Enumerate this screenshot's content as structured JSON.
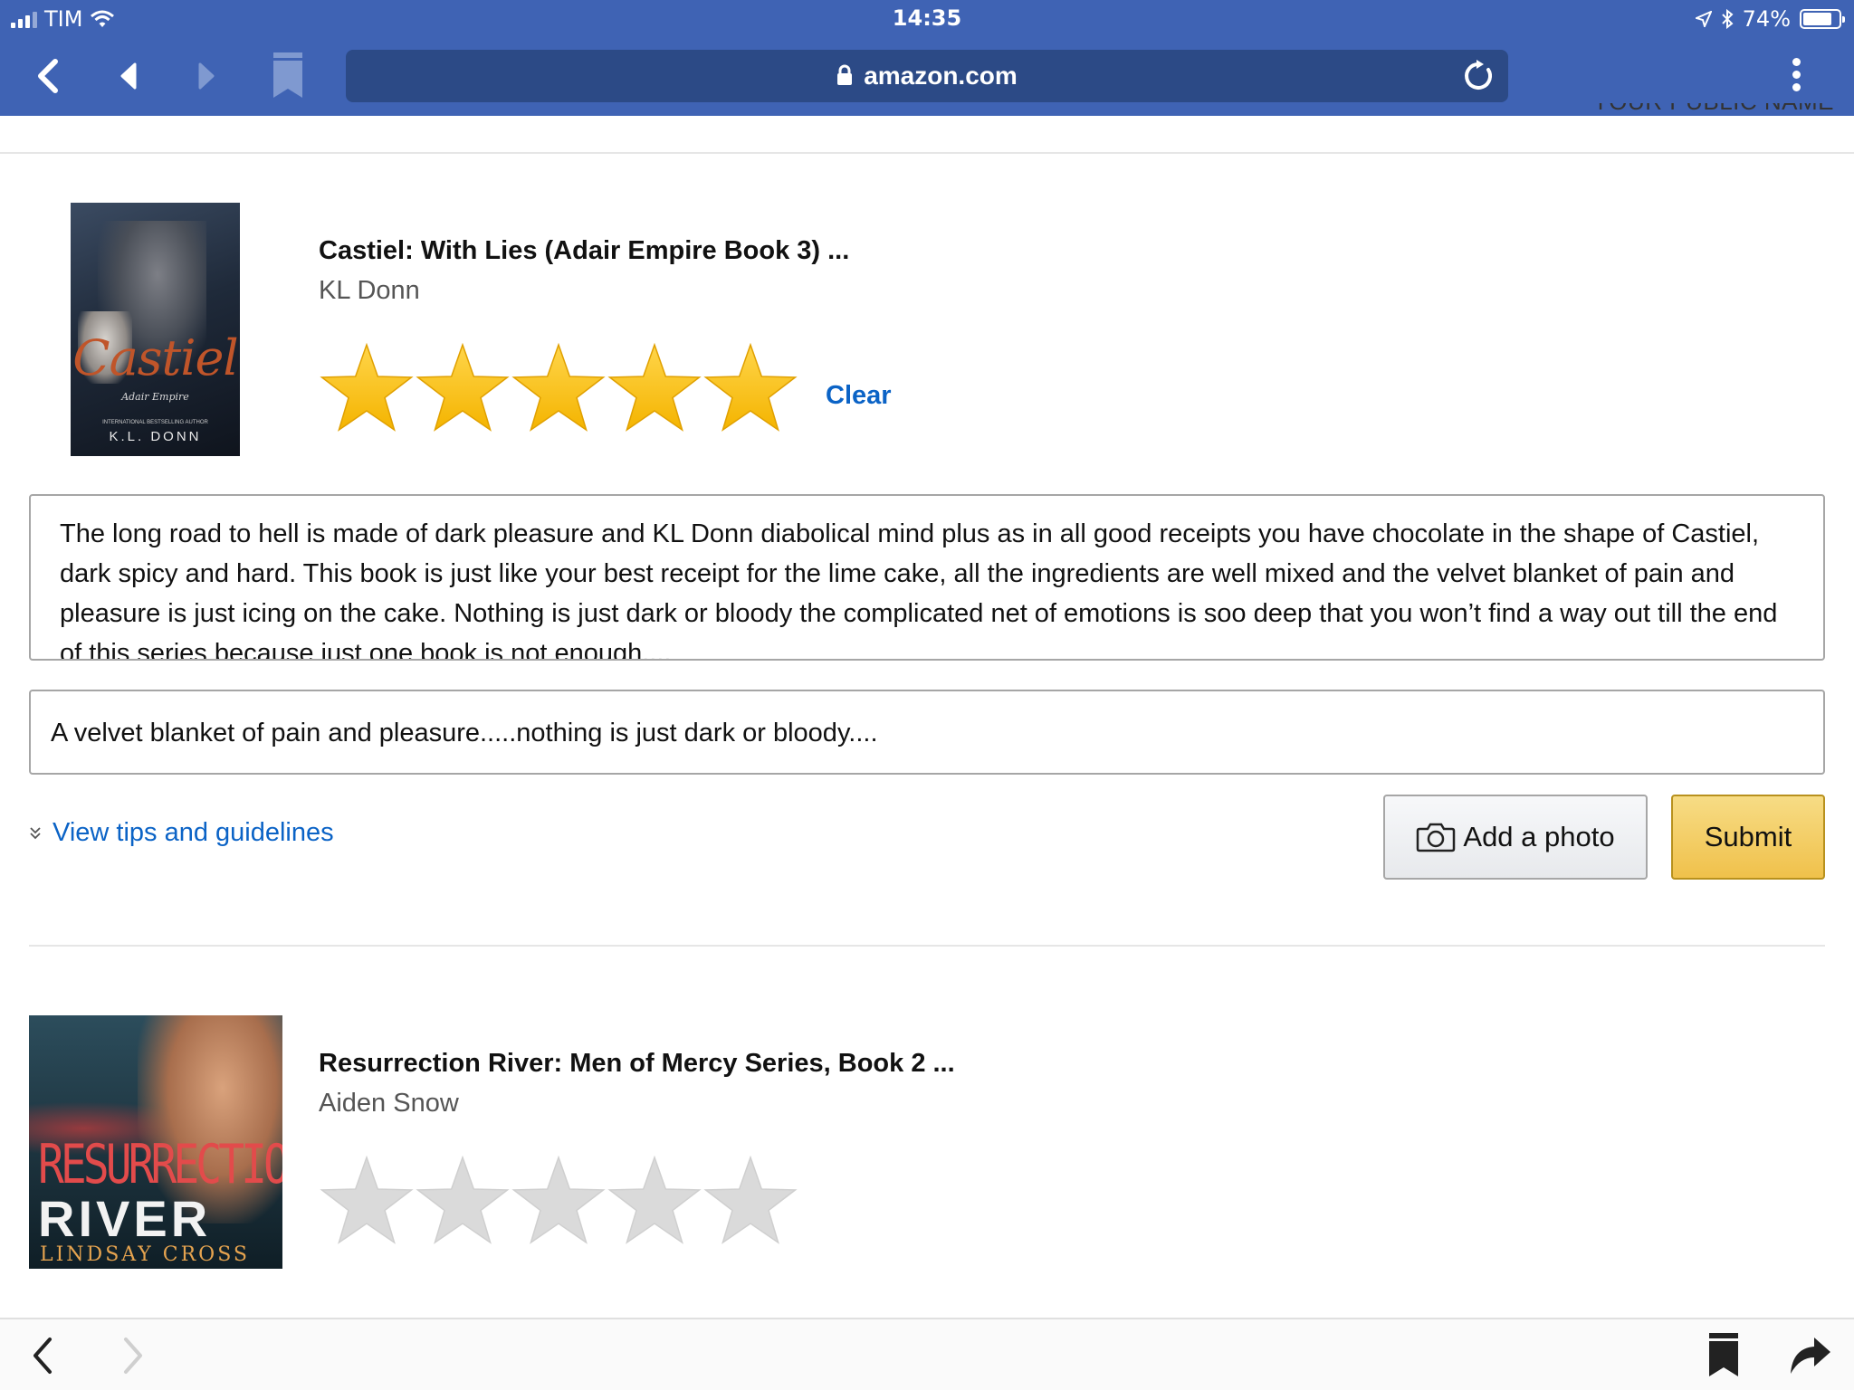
{
  "status_bar": {
    "carrier": "TIM",
    "time": "14:35",
    "battery": "74%"
  },
  "browser": {
    "url": "amazon.com"
  },
  "page": {
    "clipped_header": "YOUR PUBLIC NAME"
  },
  "reviews": [
    {
      "cover": {
        "title": "Castiel",
        "subtitle": "Adair Empire",
        "tagline": "INTERNATIONAL BESTSELLING AUTHOR",
        "author": "K.L. DONN"
      },
      "title": "Castiel: With Lies (Adair Empire Book 3) ...",
      "author": "KL Donn",
      "rating": 5,
      "rating_max": 5,
      "clear_label": "Clear",
      "review_text": "The long road to hell is made of dark pleasure and KL Donn diabolical mind plus as in all good receipts you have chocolate in the shape of Castiel, dark spicy and hard. This book is just like your best receipt for the lime cake, all the ingredients are well mixed and the velvet blanket of pain and pleasure is just icing on the cake. Nothing is just dark or bloody the complicated net of emotions is soo deep that you won’t find a way out till the end of this series because just one book is not enough....",
      "headline": "A velvet blanket of pain and pleasure.....nothing is just dark or bloody....",
      "tips_label": "View tips and guidelines",
      "add_photo_label": "Add a photo",
      "submit_label": "Submit"
    },
    {
      "cover": {
        "title_line1": "RESURRECTION",
        "title_line2": "RIVER",
        "author": "LINDSAY CROSS"
      },
      "title": "Resurrection River: Men of Mercy Series, Book 2 ...",
      "author": "Aiden Snow",
      "rating": 0,
      "rating_max": 5
    }
  ],
  "colors": {
    "chrome_blue": "#3f63b4",
    "url_bar": "#2c4a86",
    "link": "#0b63c6",
    "star_filled": "#f4b400",
    "star_empty": "#dadada",
    "submit_button": "#f0c14b"
  },
  "icons": {
    "back": "chevron-left-icon",
    "history_back": "triangle-left-icon",
    "history_forward": "triangle-right-icon",
    "bookmark": "bookmark-icon",
    "lock": "lock-icon",
    "reload": "reload-icon",
    "menu": "more-vertical-icon",
    "camera": "camera-icon",
    "share": "share-icon"
  }
}
